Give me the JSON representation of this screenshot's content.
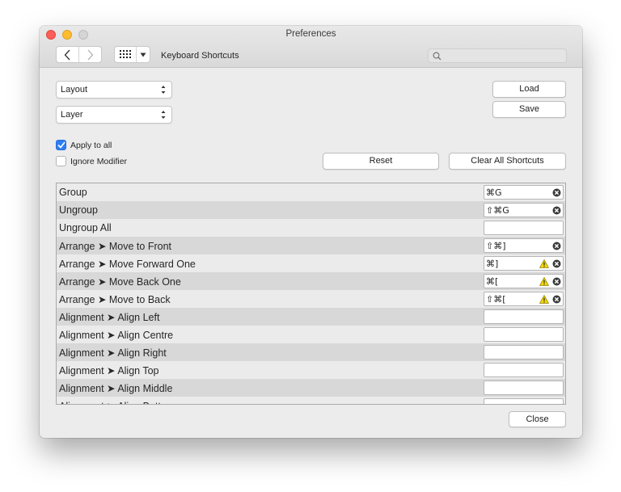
{
  "window": {
    "title": "Preferences"
  },
  "toolbar": {
    "section_label": "Keyboard Shortcuts",
    "search_placeholder": ""
  },
  "category_popup": {
    "value": "Layout"
  },
  "subcategory_popup": {
    "value": "Layer"
  },
  "buttons": {
    "load": "Load",
    "save": "Save",
    "reset": "Reset",
    "clear_all": "Clear All Shortcuts",
    "close": "Close"
  },
  "options": {
    "apply_to_all": {
      "label": "Apply to all",
      "checked": true
    },
    "ignore_modifier": {
      "label": "Ignore Modifier",
      "checked": false
    }
  },
  "shortcuts": [
    {
      "name": "Group",
      "keys": "⌘G",
      "warning": false
    },
    {
      "name": "Ungroup",
      "keys": "⇧⌘G",
      "warning": false
    },
    {
      "name": "Ungroup All",
      "keys": "",
      "warning": false
    },
    {
      "name": "Arrange ➤ Move to Front",
      "keys": "⇧⌘]",
      "warning": false
    },
    {
      "name": "Arrange ➤ Move Forward One",
      "keys": "⌘]",
      "warning": true
    },
    {
      "name": "Arrange ➤ Move Back One",
      "keys": "⌘[",
      "warning": true
    },
    {
      "name": "Arrange ➤ Move to Back",
      "keys": "⇧⌘[",
      "warning": true
    },
    {
      "name": "Alignment ➤ Align Left",
      "keys": "",
      "warning": false
    },
    {
      "name": "Alignment ➤ Align Centre",
      "keys": "",
      "warning": false
    },
    {
      "name": "Alignment ➤ Align Right",
      "keys": "",
      "warning": false
    },
    {
      "name": "Alignment ➤ Align Top",
      "keys": "",
      "warning": false
    },
    {
      "name": "Alignment ➤ Align Middle",
      "keys": "",
      "warning": false
    },
    {
      "name": "Alignment ➤ Align Bottom",
      "keys": "",
      "warning": false
    }
  ],
  "colors": {
    "accent": "#2c7ff2",
    "row_light": "#ebebeb",
    "row_dark": "#d8d8d8",
    "warning": "#f5d800"
  },
  "icons": [
    "back-arrow-icon",
    "forward-arrow-icon",
    "grid-icon",
    "dropdown-triangle-icon",
    "search-icon",
    "checkmark-icon",
    "warning-icon",
    "clear-icon",
    "updown-arrows-icon"
  ]
}
